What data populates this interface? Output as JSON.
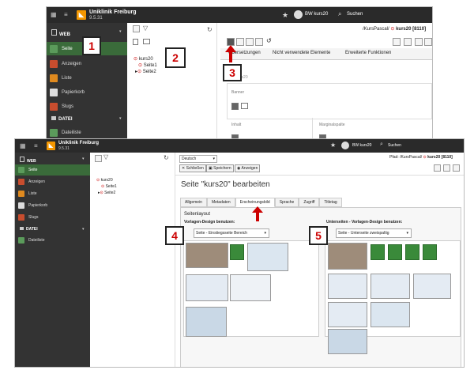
{
  "app": {
    "name": "Uniklinik Freiburg",
    "version": "9.5.31"
  },
  "user": {
    "name": "BW kurs20"
  },
  "search": {
    "label": "Suchen"
  },
  "sidebar": {
    "web_header": "WEB",
    "items": [
      "Seite",
      "Anzeigen",
      "Liste",
      "Papierkorb",
      "Slugs"
    ],
    "dateien_header": "DATEI",
    "dateiliste": "Dateiliste"
  },
  "tree": {
    "root": "kurs20",
    "children": [
      "Seite1",
      "Seite2"
    ]
  },
  "top_screen": {
    "breadcrumb": "/KursPascal/",
    "page_id": "kurs20 [8110]",
    "toolbar_tabs": [
      "Übersetzungen",
      "Nicht verwendete Elemente",
      "Erweiterte Funktionen"
    ],
    "content_root": "kurs20",
    "banner_label": "Banner",
    "inhalt_label": "Inhalt",
    "marginalspalte_label": "Marginalspalte"
  },
  "bottom_screen": {
    "language": "Deutsch",
    "close_label": "Schließen",
    "save_label": "Speichern",
    "view_label": "Anzeigen",
    "path_label": "Pfad:",
    "breadcrumb": "/KursPascal/",
    "page_id": "kurs20 [8110]",
    "edit_title": "Seite \"kurs20\" bearbeiten",
    "tabs": [
      "Allgemein",
      "Metadaten",
      "Erscheinungsbild",
      "Sprache",
      "Zugriff",
      "Titletag"
    ],
    "active_tab": "Erscheinungsbild",
    "section_title": "Seitenlayout",
    "left_label": "Vorlagen-Design benutzen:",
    "left_select": "Seite - Einstiegsseite Bereich",
    "right_label": "Unterseiten - Vorlagen-Design benutzen:",
    "right_select": "Seite - Unterseite zweispaltig"
  },
  "callouts": [
    "1",
    "2",
    "3",
    "4",
    "5"
  ],
  "colors": {
    "accent_red": "#c00000",
    "typo3_orange": "#f49700",
    "active_green": "#3a6b3a"
  }
}
